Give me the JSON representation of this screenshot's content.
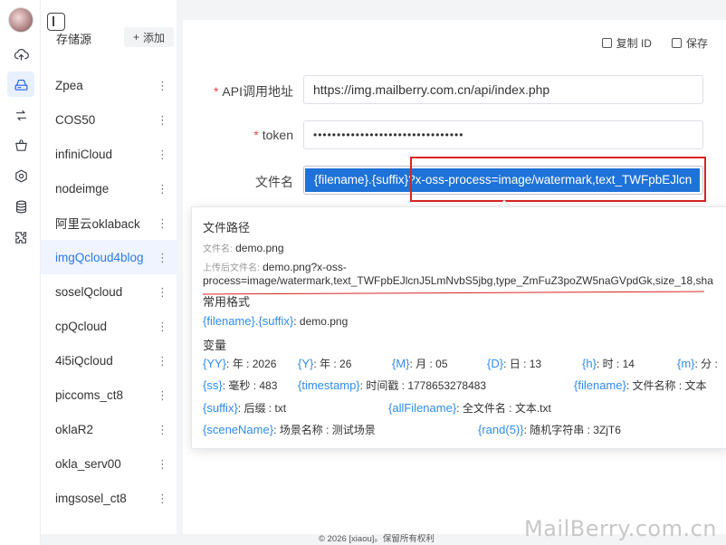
{
  "sidebar_panel": {
    "title": "存储源",
    "add_label": "添加",
    "items": [
      {
        "label": "Zpea"
      },
      {
        "label": "COS50"
      },
      {
        "label": "infiniCloud"
      },
      {
        "label": "nodeimge"
      },
      {
        "label": "阿里云oklaback"
      },
      {
        "label": "imgQcloud4blog",
        "selected": true
      },
      {
        "label": "soselQcloud"
      },
      {
        "label": "cpQcloud"
      },
      {
        "label": "4i5iQcloud"
      },
      {
        "label": "piccoms_ct8"
      },
      {
        "label": "oklaR2"
      },
      {
        "label": "okla_serv00"
      },
      {
        "label": "imgsosel_ct8"
      }
    ]
  },
  "nav_icons": [
    "upload-cloud-icon",
    "storage-drive-icon",
    "transfer-arrows-icon",
    "basket-icon",
    "settings-hexagon-icon",
    "database-icon",
    "plugin-puzzle-icon"
  ],
  "toolbar": {
    "copy_id_label": "复制 ID",
    "save_label": "保存"
  },
  "form": {
    "api_label": "API调用地址",
    "api_value": "https://img.mailberry.com.cn/api/index.php",
    "token_label": "token",
    "token_value": "••••••••••••••••••••••••••••••••",
    "filename_label": "文件名",
    "filename_value": "{filename}.{suffix}?x-oss-process=image/watermark,text_TWFpbEJlcn"
  },
  "popover": {
    "title": "文件路径",
    "filename_label": "文件名:",
    "filename_value": "demo.png",
    "uploaded_label": "上传后文件名:",
    "uploaded_value_line1": "demo.png?x-oss-",
    "uploaded_value_line2": "process=image/watermark,text_TWFpbEJlcnJ5LmNvbS5jbg,type_ZmFuZ3poZW5naGVpdGk,size_18,sha",
    "common_heading": "常用格式",
    "common_format_var": "{filename}.{suffix}",
    "common_format_value": ": demo.png",
    "vars_heading": "变量",
    "vars": [
      {
        "var": "{YY}",
        "desc": ": 年 : 2026"
      },
      {
        "var": "{Y}",
        "desc": ": 年 : 26"
      },
      {
        "var": "{M}",
        "desc": ": 月 : 05"
      },
      {
        "var": "{D}",
        "desc": ": 日 : 13"
      },
      {
        "var": "{h}",
        "desc": ": 时 : 14"
      },
      {
        "var": "{m}",
        "desc": ": 分 :"
      },
      {
        "var": "{ss}",
        "desc": ": 毫秒 : 483"
      },
      {
        "var": "{timestamp}",
        "desc": ": 时间戳 : 1778653278483"
      },
      {
        "var": "{filename}",
        "desc": ": 文件名称 : 文本"
      },
      {
        "var": "{suffix}",
        "desc": ": 后缀 : txt"
      },
      {
        "var": "{allFilename}",
        "desc": ": 全文件名 : 文本.txt"
      },
      {
        "var": "{sceneName}",
        "desc": ": 场景名称 : 测试场景"
      },
      {
        "var": "{rand(5)}",
        "desc": ": 随机字符串 : 3ZjT6"
      }
    ]
  },
  "footer": "© 2026 [xiaou]。保留所有权利",
  "watermark": "MailBerry.com.cn",
  "colors": {
    "accent": "#2c7be5",
    "required": "#e5484d",
    "annotation": "#d92323",
    "selection": "#1e72d8"
  }
}
